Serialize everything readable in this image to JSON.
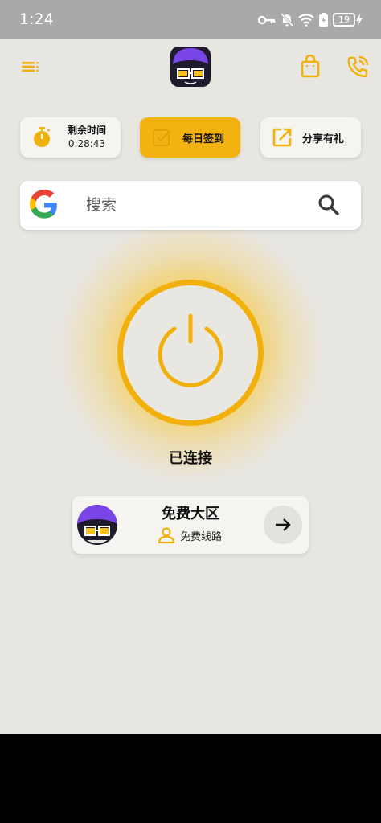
{
  "status_bar": {
    "time": "1:24",
    "battery": "19"
  },
  "header": {
    "menu_icon": "menu-icon",
    "logo_icon": "app-logo",
    "shop_icon": "shopping-bag-icon",
    "support_icon": "phone-icon"
  },
  "chips": {
    "timer": {
      "title": "剩余时间",
      "value": "0:28:43",
      "icon": "stopwatch-icon"
    },
    "checkin": {
      "label": "每日签到",
      "icon": "checkbox-icon"
    },
    "share": {
      "label": "分享有礼",
      "icon": "share-icon"
    }
  },
  "search": {
    "placeholder": "搜索",
    "engine_icon": "google-icon",
    "search_icon": "search-icon"
  },
  "connection": {
    "status": "已连接",
    "power_icon": "power-icon"
  },
  "server": {
    "name": "免费大区",
    "line": "免费线路",
    "avatar": "server-avatar",
    "arrow_icon": "arrow-right-icon"
  },
  "colors": {
    "accent": "#f3b20f",
    "background": "#e8e6e1",
    "card": "#f5f4f1",
    "purple": "#6a3fd1"
  }
}
